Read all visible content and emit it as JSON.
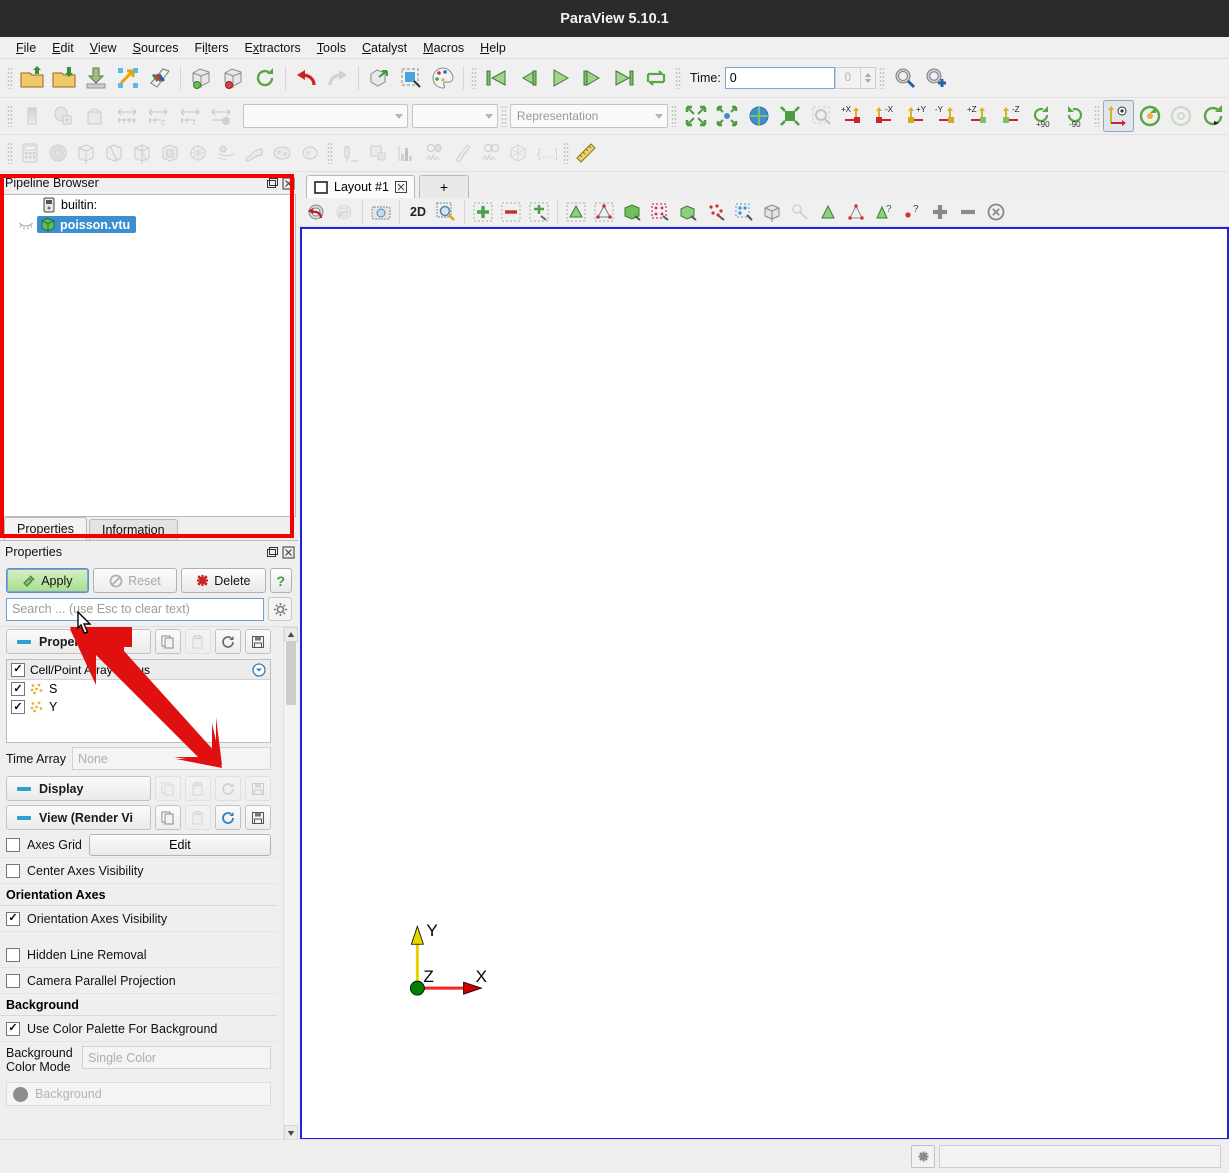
{
  "window": {
    "title": "ParaView 5.10.1"
  },
  "menu": [
    {
      "label": "File",
      "accel": "F"
    },
    {
      "label": "Edit",
      "accel": "E"
    },
    {
      "label": "View",
      "accel": "V"
    },
    {
      "label": "Sources",
      "accel": "S"
    },
    {
      "label": "Filters",
      "accel": "l"
    },
    {
      "label": "Extractors",
      "accel": "x"
    },
    {
      "label": "Tools",
      "accel": "T"
    },
    {
      "label": "Catalyst",
      "accel": "C"
    },
    {
      "label": "Macros",
      "accel": "M"
    },
    {
      "label": "Help",
      "accel": "H"
    }
  ],
  "toolbar_main": {
    "icons": [
      "open-file-icon",
      "open-recent-icon",
      "save-data-icon",
      "save-screenshot-icon",
      "save-animation-icon",
      "connect-server-icon",
      "disconnect-server-icon",
      "reset-session-icon",
      "undo-icon",
      "redo-icon",
      "camera-undo-icon",
      "interactive-select-icon",
      "load-palette-icon"
    ],
    "vcr": [
      "first-frame-icon",
      "previous-frame-icon",
      "play-icon",
      "next-frame-icon",
      "last-frame-icon",
      "loop-icon"
    ],
    "time_label": "Time:",
    "time_value": "0",
    "frame_value": "0",
    "macros": [
      "python-shell-icon",
      "add-camera-icon"
    ]
  },
  "toolbar_repr": {
    "icons": [
      "solid-color-icon",
      "color-legend-icon",
      "edit-color-map-icon",
      "rescale-range-icon",
      "rescale-custom-icon",
      "rescale-temporal-icon",
      "rescale-visible-icon"
    ],
    "array_combo": "",
    "component_combo": "",
    "representation_combo": "Representation"
  },
  "toolbar_camera": {
    "icons": [
      "reset-camera-icon",
      "zoom-to-data-icon",
      "reset-center-icon",
      "zoom-closest-icon",
      "rubber-band-zoom-icon"
    ],
    "axis_views": [
      "+X",
      "-X",
      "+Y",
      "-Y",
      "+Z",
      "-Z"
    ],
    "rotate": [
      "+90",
      "-90"
    ],
    "extras": [
      "show-center-icon",
      "pick-center-icon",
      "reset-center-axes-icon",
      "rotation-center-icon"
    ]
  },
  "toolbar_filters": {
    "icons": [
      "calculator-icon",
      "contour-icon",
      "clip-icon",
      "slice-icon",
      "threshold-icon",
      "extract-subset-icon",
      "glyph-icon",
      "stream-tracer-icon",
      "warp-icon",
      "group-datasets-icon",
      "extract-level-icon",
      "plot-over-line-icon",
      "extract-selection-icon",
      "histogram-icon",
      "plot-data-over-time-icon",
      "spreadsheet-icon",
      "plot-selection-icon",
      "python-calculator-icon",
      "programmable-filter-icon",
      "ruler-icon"
    ]
  },
  "pipeline": {
    "panel_title": "Pipeline Browser",
    "panel_buttons": [
      "undock-icon",
      "close-icon"
    ],
    "server_node": {
      "label": "builtin:",
      "icon": "server-icon"
    },
    "items": [
      {
        "label": "poisson.vtu",
        "icon": "unstructured-grid-icon",
        "selected": true,
        "visibility_icon": "eye-closed-icon"
      }
    ]
  },
  "properties_panel": {
    "tabs": [
      {
        "label": "Properties",
        "active": true
      },
      {
        "label": "Information",
        "active": false
      }
    ],
    "panel_title": "Properties",
    "panel_buttons": [
      "undock-icon",
      "close-icon"
    ],
    "buttons": {
      "apply": "Apply",
      "reset": "Reset",
      "delete": "Delete",
      "help": "?"
    },
    "search_placeholder": "Search ... (use Esc to clear text)",
    "gear": "gear-icon",
    "sections": [
      {
        "title": "Properties (p",
        "buttons": [
          "copy-icon",
          "paste-icon",
          "restore-defaults-icon",
          "save-defaults-icon"
        ]
      },
      {
        "title": "Display",
        "buttons": [
          "copy-icon",
          "paste-icon",
          "restore-defaults-icon",
          "save-defaults-icon"
        ]
      },
      {
        "title": "View (Render Vi",
        "buttons": [
          "copy-icon",
          "paste-icon",
          "restore-defaults-icon",
          "save-defaults-icon"
        ]
      }
    ],
    "array_status": {
      "header": "Cell/Point Array Status",
      "header_checked": true,
      "expand_icon": "chevron-down-circle-icon",
      "rows": [
        {
          "label": "S",
          "checked": true,
          "icon": "point-data-icon"
        },
        {
          "label": "Y",
          "checked": true,
          "icon": "point-data-icon"
        }
      ]
    },
    "time_array": {
      "label": "Time Array",
      "value": "None",
      "enabled": false
    },
    "view_options": {
      "axes_grid": {
        "label": "Axes Grid",
        "checked": false,
        "edit_label": "Edit"
      },
      "center_axes_visibility": {
        "label": "Center Axes Visibility",
        "checked": false
      },
      "orientation_axes_group": "Orientation Axes",
      "orientation_axes_visibility": {
        "label": "Orientation Axes Visibility",
        "checked": true
      },
      "hidden_line_removal": {
        "label": "Hidden Line Removal",
        "checked": false
      },
      "camera_parallel_projection": {
        "label": "Camera Parallel Projection",
        "checked": false
      },
      "background_group": "Background",
      "use_color_palette": {
        "label": "Use Color Palette For Background",
        "checked": true
      },
      "background_color_mode": {
        "label": "Background Color Mode",
        "value": "Single Color",
        "enabled": false
      },
      "background_color": {
        "label": "Background",
        "enabled": false,
        "swatch": "#8d8d8d"
      }
    }
  },
  "layout": {
    "tabs": [
      {
        "label": "Layout #1",
        "close": "close-icon",
        "active": true
      }
    ],
    "new_tab": "+",
    "view_toolbar": {
      "icons": [
        "camera-undo-icon",
        "camera-redo-icon",
        "capture-screenshot-icon"
      ],
      "mode_2d": "2D",
      "more_icons": [
        "magnify-icon",
        "add-selection-icon",
        "subtract-selection-icon",
        "toggle-selection-icon",
        "select-cells-icon",
        "select-points-icon",
        "frustum-cells-icon",
        "frustum-points-icon",
        "select-blocks-icon",
        "select-cells-polygon-icon",
        "select-points-polygon-icon",
        "select-block-icon",
        "interactive-select-icon",
        "hover-cells-icon",
        "hover-points-icon",
        "query-cells-icon",
        "query-points-icon",
        "grow-selection-icon",
        "shrink-selection-icon",
        "clear-selection-icon"
      ]
    }
  },
  "render_view": {
    "background": "#ffffff",
    "border_color": "#2222dd",
    "orientation_axes": {
      "x_label": "X",
      "x_color": "#ff0000",
      "y_label": "Y",
      "y_color": "#ffff00",
      "z_label": "Z",
      "z_color": "#008000"
    }
  },
  "status_bar": {
    "button_icon": "abort-icon",
    "progress_text": ""
  },
  "annotations": {
    "highlight_box_color": "#f50000",
    "arrow_color": "#e01010",
    "arrow_points_to": "apply-button"
  }
}
